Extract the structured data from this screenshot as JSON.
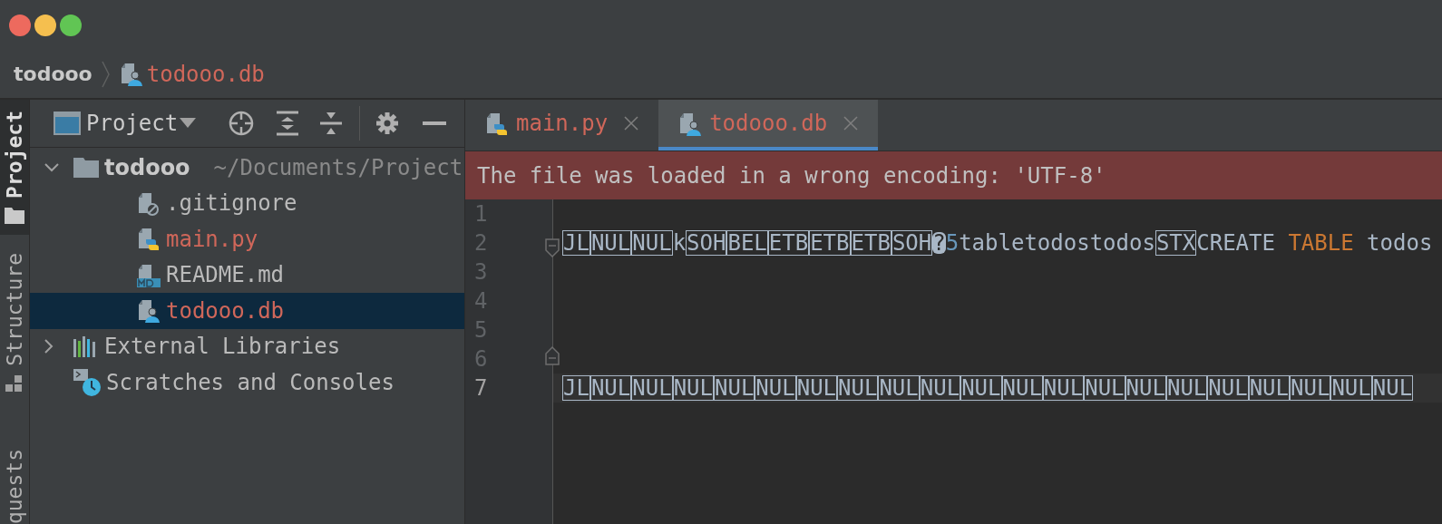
{
  "breadcrumb": [
    {
      "label": "todooo",
      "kind": "folder",
      "color": "#c9c9c9"
    },
    {
      "label": "todooo.db",
      "kind": "db",
      "color": "#d0675a"
    }
  ],
  "tool_strip": [
    {
      "label": "Project",
      "kind": "project",
      "selected": true
    },
    {
      "label": "Structure",
      "kind": "structure",
      "selected": false
    },
    {
      "label": "quests",
      "kind": "plain",
      "selected": false
    }
  ],
  "project_panel": {
    "title": "Project",
    "tree": [
      {
        "label": "todooo",
        "path": "~/Documents/Project",
        "kind": "folder",
        "expanded": true,
        "selected": false,
        "color": "#c9c9c9",
        "children": [
          {
            "label": ".gitignore",
            "kind": "ignore",
            "selected": false,
            "color": "#bbbbbb"
          },
          {
            "label": "main.py",
            "kind": "python",
            "selected": false,
            "color": "#d0675a"
          },
          {
            "label": "README.md",
            "kind": "md",
            "selected": false,
            "color": "#bbbbbb"
          },
          {
            "label": "todooo.db",
            "kind": "db",
            "selected": true,
            "color": "#d0675a"
          }
        ]
      },
      {
        "label": "External Libraries",
        "kind": "libraries",
        "expanded": false,
        "selected": false,
        "color": "#bbbbbb"
      },
      {
        "label": "Scratches and Consoles",
        "kind": "scratches",
        "selected": false,
        "color": "#bbbbbb"
      }
    ]
  },
  "tabs": [
    {
      "label": "main.py",
      "kind": "python",
      "selected": false,
      "color": "#d0675a"
    },
    {
      "label": "todooo.db",
      "kind": "db",
      "selected": true,
      "color": "#d0675a"
    }
  ],
  "banner": {
    "text": "The file was loaded in a wrong encoding: 'UTF-8'"
  },
  "editor": {
    "lines": [
      {
        "number": "1",
        "current": false,
        "fold_start": false,
        "fold_end": false
      },
      {
        "number": "2",
        "current": false,
        "fold_start": true,
        "fold_end": false,
        "segments": [
          {
            "text": "JL",
            "kind": "control"
          },
          {
            "text": "NUL",
            "kind": "control"
          },
          {
            "text": "NUL",
            "kind": "control"
          },
          {
            "text": "k",
            "kind": "plain"
          },
          {
            "text": "SOH",
            "kind": "control"
          },
          {
            "text": "BEL",
            "kind": "control"
          },
          {
            "text": "ETB",
            "kind": "control"
          },
          {
            "text": "ETB",
            "kind": "control"
          },
          {
            "text": "ETB",
            "kind": "control"
          },
          {
            "text": "SOH",
            "kind": "control"
          },
          {
            "text": "?",
            "kind": "unknown"
          },
          {
            "text": "5",
            "kind": "number"
          },
          {
            "text": "tabletodostodos",
            "kind": "plain"
          },
          {
            "text": "STX",
            "kind": "control"
          },
          {
            "text": "CREATE ",
            "kind": "plain"
          },
          {
            "text": "TABLE",
            "kind": "keyword"
          },
          {
            "text": " todos",
            "kind": "plain"
          }
        ]
      },
      {
        "number": "3",
        "current": false,
        "fold_start": false,
        "fold_end": false
      },
      {
        "number": "4",
        "current": false,
        "fold_start": false,
        "fold_end": false
      },
      {
        "number": "5",
        "current": false,
        "fold_start": false,
        "fold_end": false
      },
      {
        "number": "6",
        "current": false,
        "fold_start": false,
        "fold_end": true
      },
      {
        "number": "7",
        "current": true,
        "fold_start": false,
        "fold_end": false,
        "segments": [
          {
            "text": "JL",
            "kind": "control"
          },
          {
            "text": "NUL",
            "kind": "control"
          },
          {
            "text": "NUL",
            "kind": "control"
          },
          {
            "text": "NUL",
            "kind": "control"
          },
          {
            "text": "NUL",
            "kind": "control"
          },
          {
            "text": "NUL",
            "kind": "control"
          },
          {
            "text": "NUL",
            "kind": "control"
          },
          {
            "text": "NUL",
            "kind": "control"
          },
          {
            "text": "NUL",
            "kind": "control"
          },
          {
            "text": "NUL",
            "kind": "control"
          },
          {
            "text": "NUL",
            "kind": "control"
          },
          {
            "text": "NUL",
            "kind": "control"
          },
          {
            "text": "NUL",
            "kind": "control"
          },
          {
            "text": "NUL",
            "kind": "control"
          },
          {
            "text": "NUL",
            "kind": "control"
          },
          {
            "text": "NUL",
            "kind": "control"
          },
          {
            "text": "NUL",
            "kind": "control"
          },
          {
            "text": "NUL",
            "kind": "control"
          },
          {
            "text": "NUL",
            "kind": "control"
          },
          {
            "text": "NUL",
            "kind": "control"
          },
          {
            "text": "NUL",
            "kind": "control"
          }
        ]
      }
    ]
  }
}
